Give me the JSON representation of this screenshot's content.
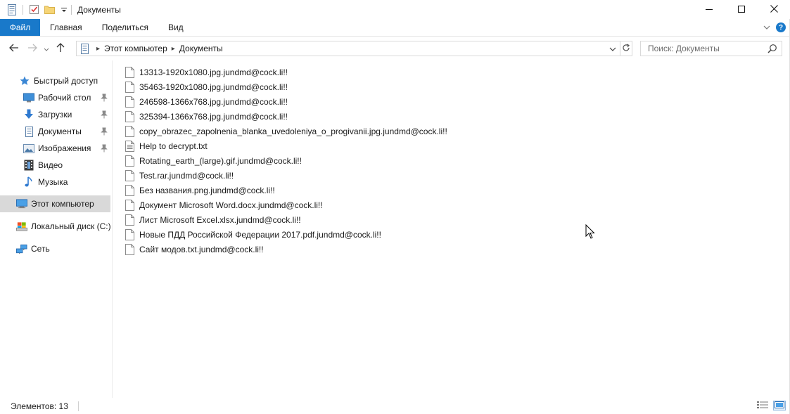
{
  "window": {
    "title": "Документы",
    "minimize_icon": "minimize-icon",
    "maximize_icon": "maximize-icon",
    "close_icon": "close-icon"
  },
  "ribbon": {
    "file_tab": "Файл",
    "tabs": [
      "Главная",
      "Поделиться",
      "Вид"
    ],
    "help": "?",
    "accent_color": "#1979ca"
  },
  "address": {
    "crumbs": [
      "Этот компьютер",
      "Документы"
    ],
    "search_placeholder": "Поиск: Документы"
  },
  "sidebar": {
    "items": [
      {
        "label": "Быстрый доступ",
        "icon": "star-icon"
      },
      {
        "label": "Рабочий стол",
        "icon": "desktop-icon",
        "pinned": true
      },
      {
        "label": "Загрузки",
        "icon": "download-icon",
        "pinned": true
      },
      {
        "label": "Документы",
        "icon": "documents-icon",
        "pinned": true
      },
      {
        "label": "Изображения",
        "icon": "pictures-icon",
        "pinned": true
      },
      {
        "label": "Видео",
        "icon": "video-icon"
      },
      {
        "label": "Музыка",
        "icon": "music-icon"
      },
      {
        "label": "Этот компьютер",
        "icon": "computer-icon",
        "selected": true
      },
      {
        "label": "Локальный диск (C:)",
        "icon": "drive-icon"
      },
      {
        "label": "Сеть",
        "icon": "network-icon"
      }
    ]
  },
  "files": [
    {
      "name": "13313-1920x1080.jpg.jundmd@cock.li!!",
      "icon": "file-icon"
    },
    {
      "name": "35463-1920x1080.jpg.jundmd@cock.li!!",
      "icon": "file-icon"
    },
    {
      "name": "246598-1366x768.jpg.jundmd@cock.li!!",
      "icon": "file-icon"
    },
    {
      "name": "325394-1366x768.jpg.jundmd@cock.li!!",
      "icon": "file-icon"
    },
    {
      "name": "copy_obrazec_zapolnenia_blanka_uvedoleniya_o_progivanii.jpg.jundmd@cock.li!!",
      "icon": "file-icon"
    },
    {
      "name": "Help to decrypt.txt",
      "icon": "text-file-icon"
    },
    {
      "name": "Rotating_earth_(large).gif.jundmd@cock.li!!",
      "icon": "file-icon"
    },
    {
      "name": "Test.rar.jundmd@cock.li!!",
      "icon": "file-icon"
    },
    {
      "name": "Без названия.png.jundmd@cock.li!!",
      "icon": "file-icon"
    },
    {
      "name": "Документ Microsoft Word.docx.jundmd@cock.li!!",
      "icon": "file-icon"
    },
    {
      "name": "Лист Microsoft Excel.xlsx.jundmd@cock.li!!",
      "icon": "file-icon"
    },
    {
      "name": "Новые ПДД Российской Федерации 2017.pdf.jundmd@cock.li!!",
      "icon": "file-icon"
    },
    {
      "name": "Сайт модов.txt.jundmd@cock.li!!",
      "icon": "file-icon"
    }
  ],
  "status": {
    "items_count": "Элементов: 13"
  }
}
